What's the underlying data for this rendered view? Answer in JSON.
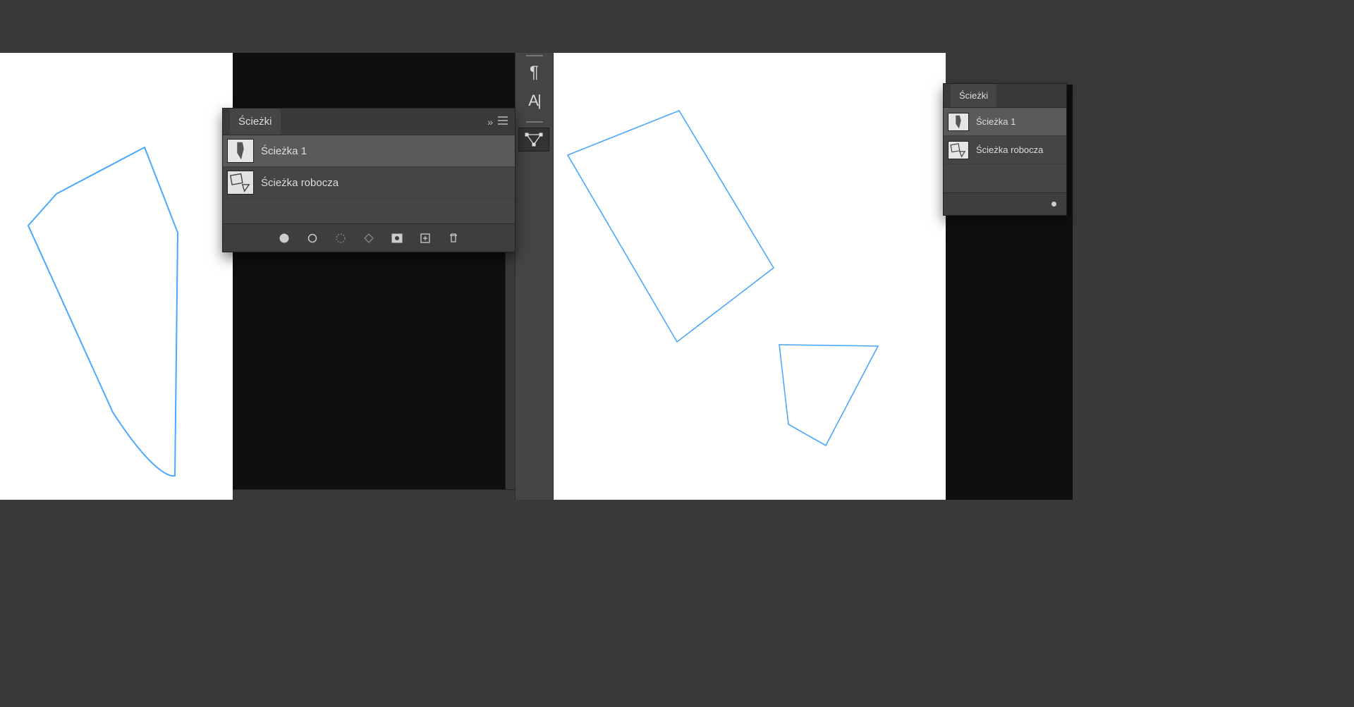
{
  "panel_left": {
    "title": "Ścieżki",
    "items": [
      {
        "label": "Ścieżka 1",
        "selected": true
      },
      {
        "label": "Ścieżka robocza",
        "selected": false
      }
    ],
    "footer_icons": [
      "fill-circle",
      "stroke-circle",
      "selection-to-path",
      "path-to-selection",
      "mask",
      "new",
      "delete"
    ]
  },
  "panel_right": {
    "title": "Ścieżki",
    "items": [
      {
        "label": "Ścieżka 1",
        "selected": true
      },
      {
        "label": "Ścieżka robocza",
        "selected": false
      }
    ]
  },
  "toolbar": {
    "paragraph_icon": "¶",
    "text_cursor_label": "A|"
  }
}
